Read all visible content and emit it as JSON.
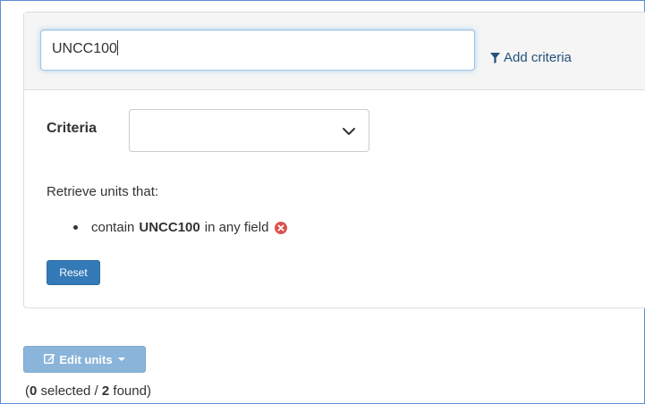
{
  "search": {
    "value": "UNCC100",
    "add_criteria_label": "Add criteria"
  },
  "criteria": {
    "label": "Criteria",
    "selected": ""
  },
  "retrieve": {
    "intro": "Retrieve units that:",
    "items": [
      {
        "prefix": "contain",
        "term": "UNCC100",
        "suffix": "in any field"
      }
    ]
  },
  "buttons": {
    "reset_label": "Reset",
    "edit_units_label": "Edit units"
  },
  "summary": {
    "open": "(",
    "selected_count": "0",
    "selected_text": "selected /",
    "found_count": "2",
    "found_text": "found)"
  },
  "colors": {
    "primary": "#337ab7",
    "primary_disabled": "#8ab4da",
    "remove_icon": "#d9534f",
    "link": "#23527c"
  },
  "icons": {
    "add_criteria": "funnel-icon",
    "select": "chevron-down-icon",
    "remove": "remove-circle-icon",
    "edit": "edit-icon",
    "dropdown": "caret-down-icon"
  }
}
